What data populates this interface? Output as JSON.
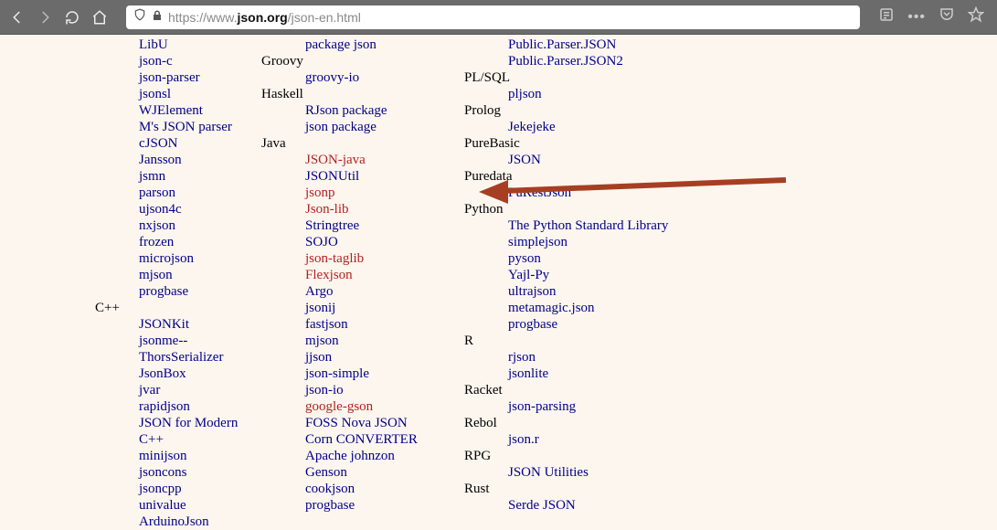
{
  "url": {
    "prefix_https": "https://www.",
    "domain": "json.org",
    "path": "/json-en.html"
  },
  "col1": {
    "headless": [
      "LibU",
      "json-c",
      "json-parser",
      "jsonsl",
      "WJElement",
      "M's JSON parser",
      "cJSON",
      "Jansson",
      "jsmn",
      "parson",
      "ujson4c",
      "nxjson",
      "frozen",
      "microjson",
      "mjson",
      "progbase"
    ],
    "cpp_heading": "C++",
    "cpp_items": [
      "JSONKit",
      "jsonme--",
      "ThorsSerializer",
      "JsonBox",
      "jvar",
      "rapidjson",
      "JSON for Modern C++",
      "minijson",
      "jsoncons",
      "jsoncpp",
      "univalue",
      "ArduinoJson"
    ]
  },
  "col2": {
    "headless": [
      "package json"
    ],
    "groovy_heading": "Groovy",
    "groovy_items": [
      "groovy-io"
    ],
    "haskell_heading": "Haskell",
    "haskell_items": [
      "RJson package",
      "json package"
    ],
    "java_heading": "Java",
    "java_items": [
      {
        "t": "JSON-java",
        "c": "red"
      },
      {
        "t": "JSONUtil",
        "c": "link"
      },
      {
        "t": "jsonp",
        "c": "red"
      },
      {
        "t": "Json-lib",
        "c": "red"
      },
      {
        "t": "Stringtree",
        "c": "link"
      },
      {
        "t": "SOJO",
        "c": "link"
      },
      {
        "t": "json-taglib",
        "c": "red"
      },
      {
        "t": "Flexjson",
        "c": "red"
      },
      {
        "t": "Argo",
        "c": "link"
      },
      {
        "t": "jsonij",
        "c": "link"
      },
      {
        "t": "fastjson",
        "c": "link"
      },
      {
        "t": "mjson",
        "c": "link"
      },
      {
        "t": "jjson",
        "c": "link"
      },
      {
        "t": "json-simple",
        "c": "link"
      },
      {
        "t": "json-io",
        "c": "link"
      },
      {
        "t": "google-gson",
        "c": "red"
      },
      {
        "t": "FOSS Nova JSON",
        "c": "link"
      },
      {
        "t": "Corn CONVERTER",
        "c": "link"
      },
      {
        "t": "Apache johnzon",
        "c": "link"
      },
      {
        "t": "Genson",
        "c": "link"
      },
      {
        "t": "cookjson",
        "c": "link"
      },
      {
        "t": "progbase",
        "c": "link"
      }
    ]
  },
  "col3": {
    "headless": [
      "Public.Parser.JSON",
      "Public.Parser.JSON2"
    ],
    "groups": [
      {
        "heading": "PL/SQL",
        "items": [
          {
            "t": "pljson"
          }
        ]
      },
      {
        "heading": "Prolog",
        "items": [
          {
            "t": "Jekejeke"
          }
        ]
      },
      {
        "heading": "PureBasic",
        "items": [
          {
            "t": "JSON"
          }
        ]
      },
      {
        "heading": "Puredata",
        "items": [
          {
            "t": "PuRestJson"
          }
        ]
      },
      {
        "heading": "Python",
        "items": [
          {
            "t": "The Python Standard Library"
          },
          {
            "t": "simplejson"
          },
          {
            "t": "pyson"
          },
          {
            "t": "Yajl-Py"
          },
          {
            "t": "ultrajson"
          },
          {
            "t": "metamagic.json"
          },
          {
            "t": "progbase"
          }
        ]
      },
      {
        "heading": "R",
        "items": [
          {
            "t": "rjson"
          },
          {
            "t": "jsonlite"
          }
        ]
      },
      {
        "heading": "Racket",
        "items": [
          {
            "t": "json-parsing"
          }
        ]
      },
      {
        "heading": "Rebol",
        "items": [
          {
            "t": "json.r"
          }
        ]
      },
      {
        "heading": "RPG",
        "items": [
          {
            "t": "JSON Utilities"
          }
        ]
      },
      {
        "heading": "Rust",
        "items": [
          {
            "t": "Serde JSON"
          }
        ]
      }
    ]
  }
}
